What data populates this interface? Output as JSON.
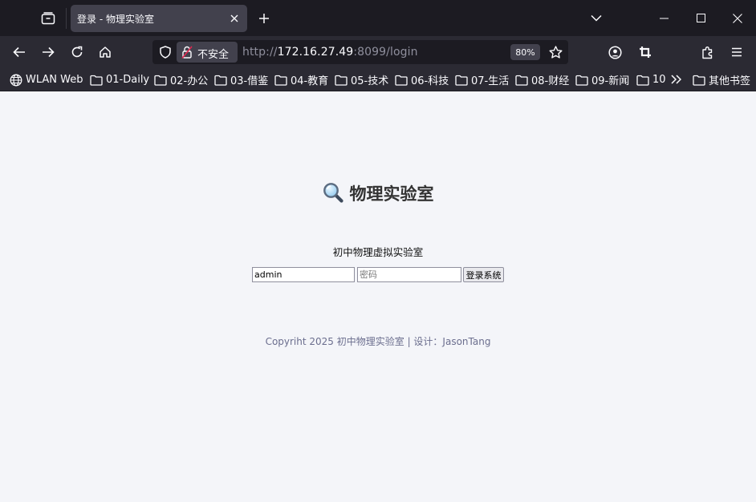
{
  "browser": {
    "tab": {
      "title": "登录 - 物理实验室"
    },
    "zoom": "80%",
    "url": {
      "scheme": "http://",
      "host": "172.16.27.49",
      "rest": ":8099/login"
    },
    "security_label": "不安全",
    "icons": [
      "tab-list-icon",
      "close-icon",
      "plus-icon",
      "chevron-down-icon",
      "minimize-icon",
      "maximize-icon",
      "back-icon",
      "forward-icon",
      "reload-icon",
      "home-icon",
      "shield-icon",
      "insecure-lock-icon",
      "star-icon",
      "account-icon",
      "crop-icon",
      "extensions-icon",
      "menu-icon",
      "globe-icon",
      "folder-icon",
      "chevrons-right-icon"
    ],
    "bookmarks": [
      {
        "label": "WLAN Web",
        "icon": "globe-icon"
      },
      {
        "label": "01-Daily",
        "icon": "folder-icon"
      },
      {
        "label": "02-办公",
        "icon": "folder-icon"
      },
      {
        "label": "03-借鉴",
        "icon": "folder-icon"
      },
      {
        "label": "04-教育",
        "icon": "folder-icon"
      },
      {
        "label": "05-技术",
        "icon": "folder-icon"
      },
      {
        "label": "06-科技",
        "icon": "folder-icon"
      },
      {
        "label": "07-生活",
        "icon": "folder-icon"
      },
      {
        "label": "08-财经",
        "icon": "folder-icon"
      },
      {
        "label": "09-新闻",
        "icon": "folder-icon"
      },
      {
        "label": "10",
        "icon": "folder-icon"
      }
    ],
    "other_bookmarks": "其他书签"
  },
  "page": {
    "brand": "物理实验室",
    "brand_icon": "magnifier-icon",
    "subtitle": "初中物理虚拟实验室",
    "form": {
      "username_value": "admin",
      "password_placeholder": "密码",
      "submit_label": "登录系统"
    },
    "footer": "Copyriht 2025 初中物理实验室 | 设计：JasonTang"
  },
  "colors": {
    "tabbar_bg": "#1c1b22",
    "toolbar_bg": "#2b2a33",
    "page_bg": "#f4f5f9",
    "footer_text": "#6b6e8e"
  }
}
